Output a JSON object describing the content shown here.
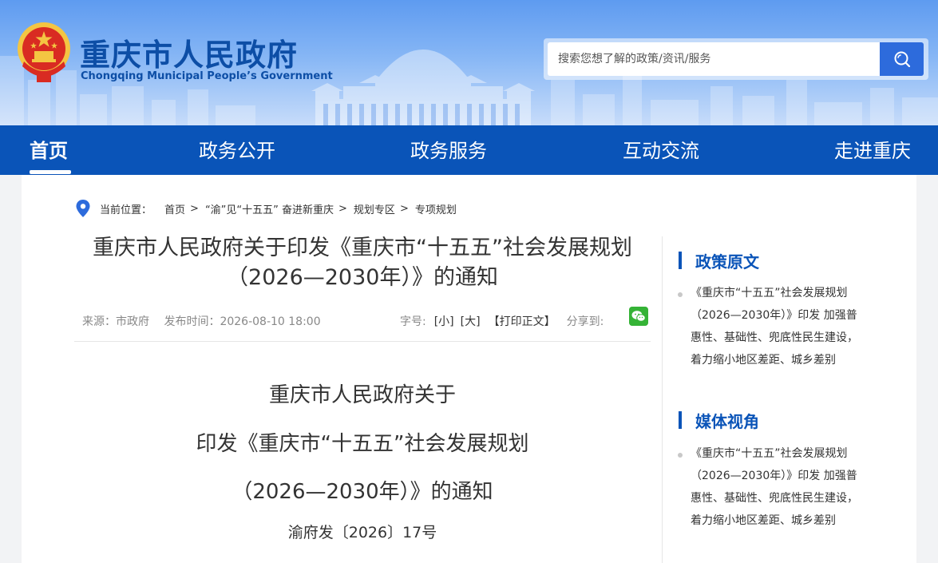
{
  "site": {
    "title": "重庆市人民政府",
    "subtitle": "Chongqing Municipal People’s Government"
  },
  "search": {
    "placeholder": "搜索您想了解的政策/资讯/服务"
  },
  "nav": {
    "items": [
      "首页",
      "政务公开",
      "政务服务",
      "互动交流",
      "走进重庆"
    ]
  },
  "breadcrumb": {
    "prefix": "当前位置：",
    "items": [
      "首页",
      "“渝”见“十五五” 奋进新重庆",
      "规划专区",
      "专项规划"
    ],
    "separator": ">"
  },
  "article": {
    "title": "重庆市人民政府关于印发《重庆市“十五五”社会发展规划（2026—2030年）》的通知",
    "source": "来源：市政府",
    "publish_time": "发布时间：2026-08-10 18:00",
    "font_label": "字号:",
    "font_small": "[小]",
    "font_large": "[大]",
    "print": "【打印正文】",
    "share": "分享到:",
    "doc_title_lines": [
      "重庆市人民政府关于",
      "印发《重庆市“十五五”社会发展规划",
      "（2026—2030年）》的通知"
    ],
    "doc_number": "渝府发〔2026〕17号"
  },
  "sidebar": {
    "sections": [
      {
        "heading": "政策原文",
        "link": "《重庆市“十五五”社会发展规划（2026—2030年）》印发 加强普惠性、基础性、兜底性民生建设，着力缩小地区差距、城乡差别"
      },
      {
        "heading": "媒体视角",
        "link": "《重庆市“十五五”社会发展规划（2026—2030年）》印发 加强普惠性、基础性、兜底性民生建设，着力缩小地区差距、城乡差别"
      }
    ]
  },
  "colors": {
    "nav_bg": "#0a54b8",
    "accent": "#0d4ea6",
    "search_button": "#2d6bdc",
    "wechat": "#35b336"
  },
  "icons": [
    "national-emblem-icon",
    "search-icon",
    "location-pin-icon",
    "wechat-icon"
  ]
}
